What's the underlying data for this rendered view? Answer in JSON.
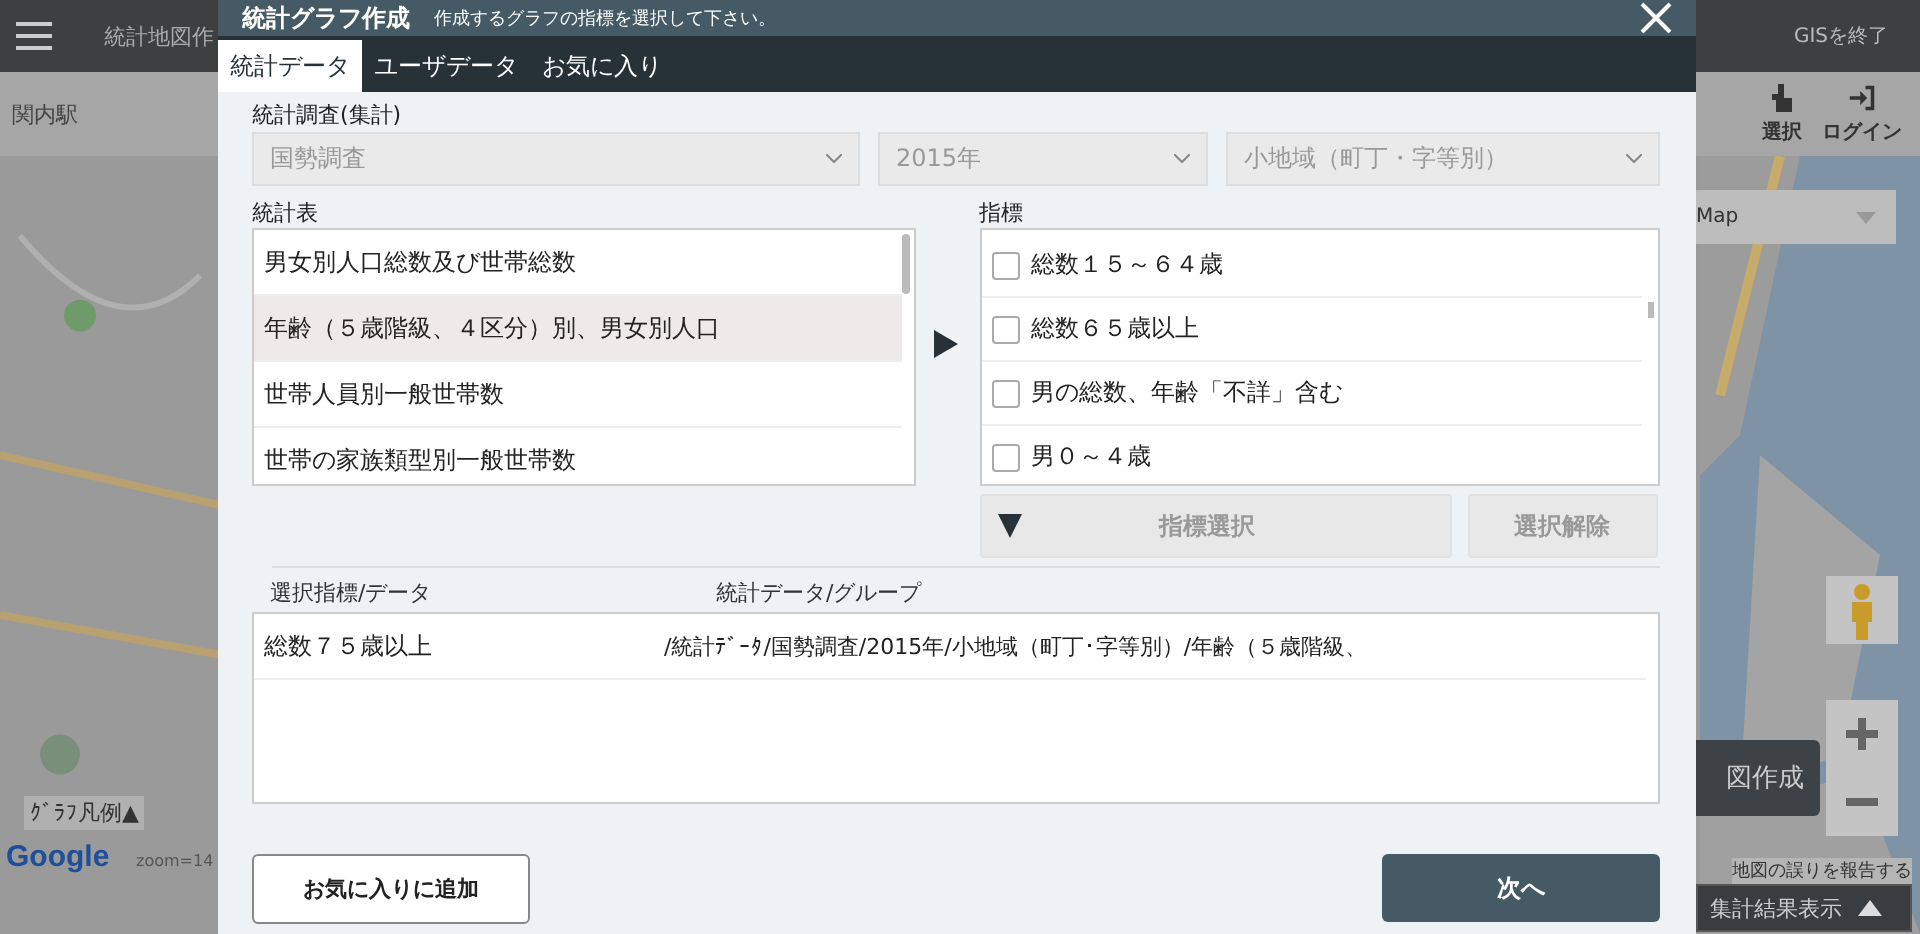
{
  "app": {
    "title": "統計地図作",
    "exit": "GISを終了",
    "location": "関内駅",
    "tools": [
      {
        "kind": "select",
        "label": "選択"
      },
      {
        "kind": "login",
        "label": "ログイン"
      }
    ],
    "map_type": "Map",
    "make_map": "図作成",
    "legend": "ｸﾞﾗﾌ凡例▲",
    "google": "Google",
    "zoom": "zoom=14",
    "report": "地図の誤りを報告する",
    "results": "集計結果表示"
  },
  "dialog": {
    "title": "統計グラフ作成",
    "subtitle": "作成するグラフの指標を選択して下さい。",
    "tabs": [
      {
        "label": "統計データ",
        "selected": true
      },
      {
        "label": "ユーザデータ",
        "selected": false
      },
      {
        "label": "お気に入り",
        "selected": false
      }
    ],
    "survey": {
      "label": "統計調査(集計)",
      "selects": [
        {
          "value": "国勢調査",
          "disabled": true
        },
        {
          "value": "2015年",
          "disabled": true
        },
        {
          "value": "小地域（町丁・字等別）",
          "disabled": true
        }
      ]
    },
    "tables": {
      "label": "統計表",
      "items": [
        {
          "label": "男女別人口総数及び世帯総数",
          "selected": false
        },
        {
          "label": "年齢（５歳階級、４区分）別、男女別人口",
          "selected": true
        },
        {
          "label": "世帯人員別一般世帯数",
          "selected": false
        },
        {
          "label": "世帯の家族類型別一般世帯数",
          "selected": false
        }
      ]
    },
    "indicators": {
      "label": "指標",
      "items": [
        {
          "label": "総数１５～６４歳",
          "checked": false
        },
        {
          "label": "総数６５歳以上",
          "checked": false
        },
        {
          "label": "男の総数、年齢「不詳」含む",
          "checked": false
        },
        {
          "label": "男０～４歳",
          "checked": false
        }
      ]
    },
    "select_button": {
      "label": "指標選択",
      "disabled": true
    },
    "clear_button": {
      "label": "選択解除",
      "disabled": true
    },
    "selection": {
      "columns": [
        "選択指標/データ",
        "統計データ/グループ"
      ],
      "rows": [
        {
          "indicator": "総数７５歳以上",
          "path": "/統計ﾃﾞｰﾀ/国勢調査/2015年/小地域（町丁･字等別）/年齢（５歳階級、"
        }
      ]
    },
    "favorite_button": "お気に入りに追加",
    "next_button": "次へ"
  }
}
